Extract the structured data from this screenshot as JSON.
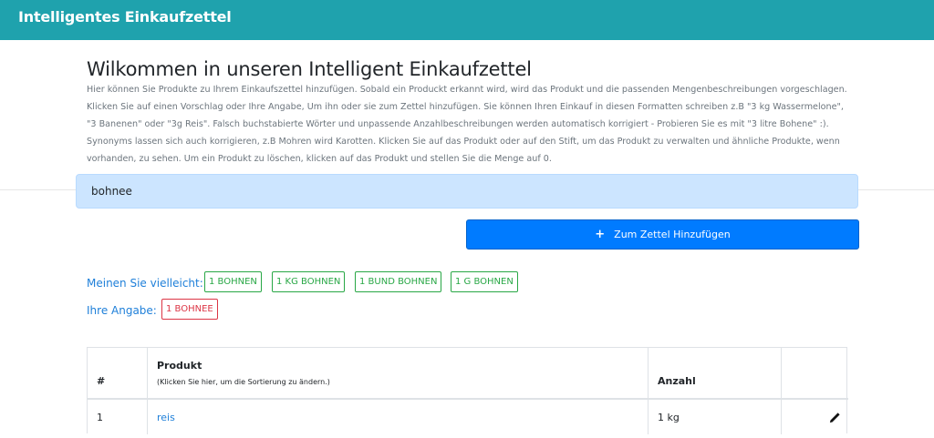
{
  "navbar": {
    "brand": "Intelligentes Einkaufzettel"
  },
  "header": {
    "title": "Wilkommen in unseren Intelligent Einkaufzettel",
    "intro": "Hier können Sie Produkte zu Ihrem Einkaufszettel hinzufügen. Sobald ein Produckt erkannt wird, wird das Produkt und die passenden Mengenbeschreibungen vorgeschlagen. Klicken Sie auf einen Vorschlag oder Ihre Angabe, Um ihn oder sie zum Zettel hinzufügen. Sie können Ihren Einkauf in diesen Formatten schreiben z.B \"3 kg Wassermelone\", \"3 Banenen\" oder \"3g Reis\". Falsch buchstabierte Wörter und unpassende Anzahlbeschreibungen werden automatisch korrigiert - Probieren Sie es mit \"3 litre Bohene\" :). Synonyms lassen sich auch korrigieren, z.B Mohren wird Karotten. Klicken Sie auf das Produkt oder auf den Stift, um das Produkt zu verwalten und ähnliche Produkte, wenn vorhanden, zu sehen. Um ein Produkt zu löschen, klicken auf das Produkt und stellen Sie die Menge auf 0."
  },
  "search": {
    "value": "bohnee"
  },
  "add_button": {
    "label": "Zum Zettel Hinzufügen",
    "icon": "plus-icon"
  },
  "suggestions": {
    "label": "Meinen Sie vielleicht:",
    "items": [
      "1 BOHNEN",
      "1 KG BOHNEN",
      "1 BUND BOHNEN",
      "1 G BOHNEN"
    ]
  },
  "user_input": {
    "label": "Ihre Angabe:",
    "value": "1 BOHNEE"
  },
  "table": {
    "headers": {
      "index": "#",
      "product": "Produkt",
      "product_hint": "(Klicken Sie hier, um die Sortierung zu ändern.)",
      "amount": "Anzahl"
    },
    "rows": [
      {
        "index": "1",
        "product": "reis",
        "amount": "1 kg",
        "action_icon": "pencil-icon"
      }
    ]
  },
  "colors": {
    "navbar": "#1fa2ad",
    "primary": "#007bff",
    "suggestion": "#28a745",
    "user_input": "#dc3545",
    "search_bg": "#cce5ff",
    "link": "#1e7fd9"
  }
}
